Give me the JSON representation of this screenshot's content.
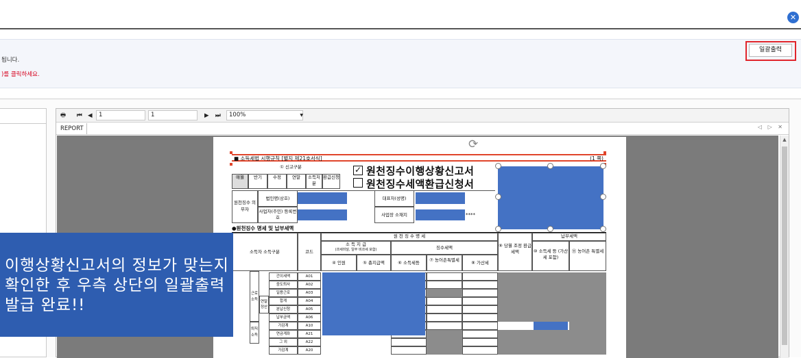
{
  "header": {
    "close_icon": "close-icon"
  },
  "notice": {
    "line1": "됩니다.",
    "line2": ")를 클릭하세요."
  },
  "actions": {
    "bulk_print_label": "일괄출력"
  },
  "viewer": {
    "page_current": "1",
    "page_total": "1",
    "zoom": "100%",
    "tab_label": "REPORT",
    "tab_controls": "◁ ▷ ✕"
  },
  "document": {
    "header_text": "■ 소득세법 시행규칙 [별지 제21호서식]",
    "page_label": "(1 쪽)",
    "report_type_label": "① 신고구분",
    "report_type_options": [
      "매월",
      "반기",
      "수정",
      "연말",
      "소득처분",
      "환급신청"
    ],
    "title_main": "원천징수이행상황신고서",
    "title_sub": "원천징수세액환급신청서",
    "withholder_label": "원천징수 의무자",
    "corp_name_label": "법인명(상호)",
    "rep_label": "대표자(성명)",
    "bizno_label": "사업자(주민) 등록번호",
    "address_label": "사업장 소재지",
    "address_mask": "****",
    "section_title": "●원천징수 명세 및 납부세액",
    "col_income_kind": "소득자 소득구분",
    "col_code": "코드",
    "col_withholding_detail": "원 천 징 수 명 세",
    "col_income_payment": "소 득 지 급",
    "col_income_payment_note": "(과세미달, 일부 비과세 포함)",
    "col_people": "④ 인원",
    "col_total_pay": "⑤ 총지급액",
    "col_tax_group": "징수세액",
    "col_income_tax": "⑥ 소득세등",
    "col_rural_tax": "⑦ 농어촌특별세",
    "col_penalty": "⑧ 가산세",
    "col_adjust": "⑨ 당월 조정 환급세액",
    "col_payment_group": "납부세액",
    "col_pay_income_tax": "⑩ 소득세 등 (가산세 포함)",
    "col_pay_rural_tax": "⑪ 농어촌 특별세",
    "group_labor": "근로 소득",
    "group_retire": "퇴직 소득",
    "group_yearend": "연말 정산",
    "rows": [
      {
        "label": "간이세액",
        "code": "A01"
      },
      {
        "label": "중도퇴사",
        "code": "A02"
      },
      {
        "label": "일용근로",
        "code": "A03"
      },
      {
        "label": "합계",
        "code": "A04"
      },
      {
        "label": "분납신청",
        "code": "A05"
      },
      {
        "label": "납부금액",
        "code": "A06"
      },
      {
        "label": "가감계",
        "code": "A10"
      },
      {
        "label": "연금계좌",
        "code": "A21"
      },
      {
        "label": "그 외",
        "code": "A22"
      },
      {
        "label": "가감계",
        "code": "A20"
      }
    ]
  },
  "callout": {
    "text": "이행상황신고서의 정보가 맞는지 확인한 후 우측 상단의 일괄출력 발급 완료!!"
  },
  "colors": {
    "accent_blue": "#4472c4",
    "callout_blue": "#2e5db0",
    "highlight_red": "#e0242a",
    "notice_red": "#d6001c"
  }
}
